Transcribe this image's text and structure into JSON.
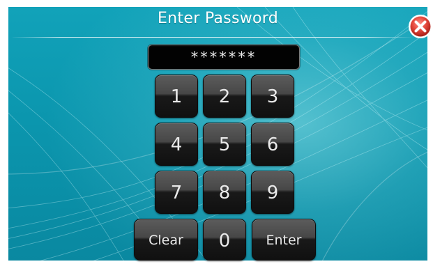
{
  "dialog": {
    "title": "Enter Password",
    "close_icon": "close-circle-x-icon"
  },
  "password": {
    "masked_value": "*******"
  },
  "keypad": {
    "keys": [
      "1",
      "2",
      "3",
      "4",
      "5",
      "6",
      "7",
      "8",
      "9"
    ],
    "clear_label": "Clear",
    "zero_label": "0",
    "enter_label": "Enter"
  },
  "colors": {
    "background_teal": "#0b96ae",
    "key_dark": "#191919",
    "close_red": "#e2453a"
  }
}
